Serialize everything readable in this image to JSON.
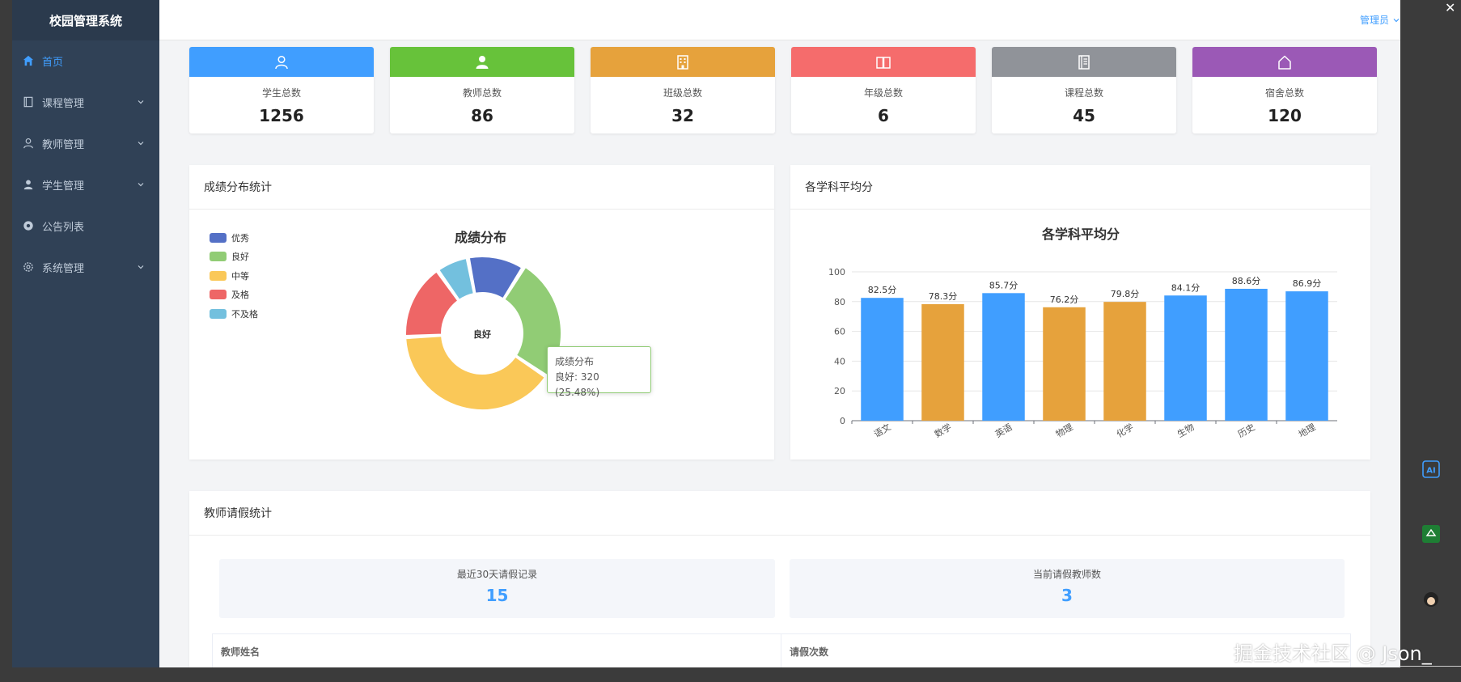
{
  "sidebar": {
    "brand": "校园管理系统",
    "items": [
      {
        "label": "首页",
        "icon": "home-icon",
        "active": true,
        "expandable": false
      },
      {
        "label": "课程管理",
        "icon": "book-icon",
        "active": false,
        "expandable": true
      },
      {
        "label": "教师管理",
        "icon": "user-icon",
        "active": false,
        "expandable": true
      },
      {
        "label": "学生管理",
        "icon": "student-icon",
        "active": false,
        "expandable": true
      },
      {
        "label": "公告列表",
        "icon": "announcement-icon",
        "active": false,
        "expandable": false
      },
      {
        "label": "系统管理",
        "icon": "gear-icon",
        "active": false,
        "expandable": true
      }
    ]
  },
  "header": {
    "user": "管理员"
  },
  "stats": [
    {
      "label": "学生总数",
      "value": "1256",
      "color": "#409eff",
      "icon": "user-outline-icon"
    },
    {
      "label": "教师总数",
      "value": "86",
      "color": "#67c23a",
      "icon": "user-solid-icon"
    },
    {
      "label": "班级总数",
      "value": "32",
      "color": "#e6a23c",
      "icon": "building-icon"
    },
    {
      "label": "年级总数",
      "value": "6",
      "color": "#f56c6c",
      "icon": "open-book-icon"
    },
    {
      "label": "课程总数",
      "value": "45",
      "color": "#909399",
      "icon": "notebook-icon"
    },
    {
      "label": "宿舍总数",
      "value": "120",
      "color": "#9b59b6",
      "icon": "house-icon"
    }
  ],
  "score_panel": {
    "title": "成绩分布统计",
    "tooltip_title": "成绩分布",
    "tooltip_value": "良好: 320 (25.48%)"
  },
  "avg_panel": {
    "title": "各学科平均分"
  },
  "leave_panel": {
    "title": "教师请假统计",
    "recent_label": "最近30天请假记录",
    "recent_value": "15",
    "current_label": "当前请假教师数",
    "current_value": "3",
    "columns": [
      "教师姓名",
      "请假次数"
    ]
  },
  "watermark": "掘金技术社区 @ Json_",
  "chart_data": [
    {
      "type": "pie",
      "title": "成绩分布",
      "center_label": "良好",
      "categories": [
        "优秀",
        "良好",
        "中等",
        "及格",
        "不及格"
      ],
      "values": [
        150,
        320,
        500,
        200,
        86
      ],
      "colors": [
        "#5470c6",
        "#91cc75",
        "#fac858",
        "#ee6666",
        "#73c0de"
      ]
    },
    {
      "type": "bar",
      "title": "各学科平均分",
      "categories": [
        "语文",
        "数学",
        "英语",
        "物理",
        "化学",
        "生物",
        "历史",
        "地理"
      ],
      "values": [
        82.5,
        78.3,
        85.7,
        76.2,
        79.8,
        84.1,
        88.6,
        86.9
      ],
      "labels": [
        "82.5分",
        "78.3分",
        "85.7分",
        "76.2分",
        "79.8分",
        "84.1分",
        "88.6分",
        "86.9分"
      ],
      "colors": [
        "#409eff",
        "#e6a23c",
        "#409eff",
        "#e6a23c",
        "#e6a23c",
        "#409eff",
        "#409eff",
        "#409eff"
      ],
      "ylim": [
        0,
        100
      ],
      "yticks": [
        "0",
        "20",
        "40",
        "60",
        "80",
        "100"
      ]
    }
  ]
}
